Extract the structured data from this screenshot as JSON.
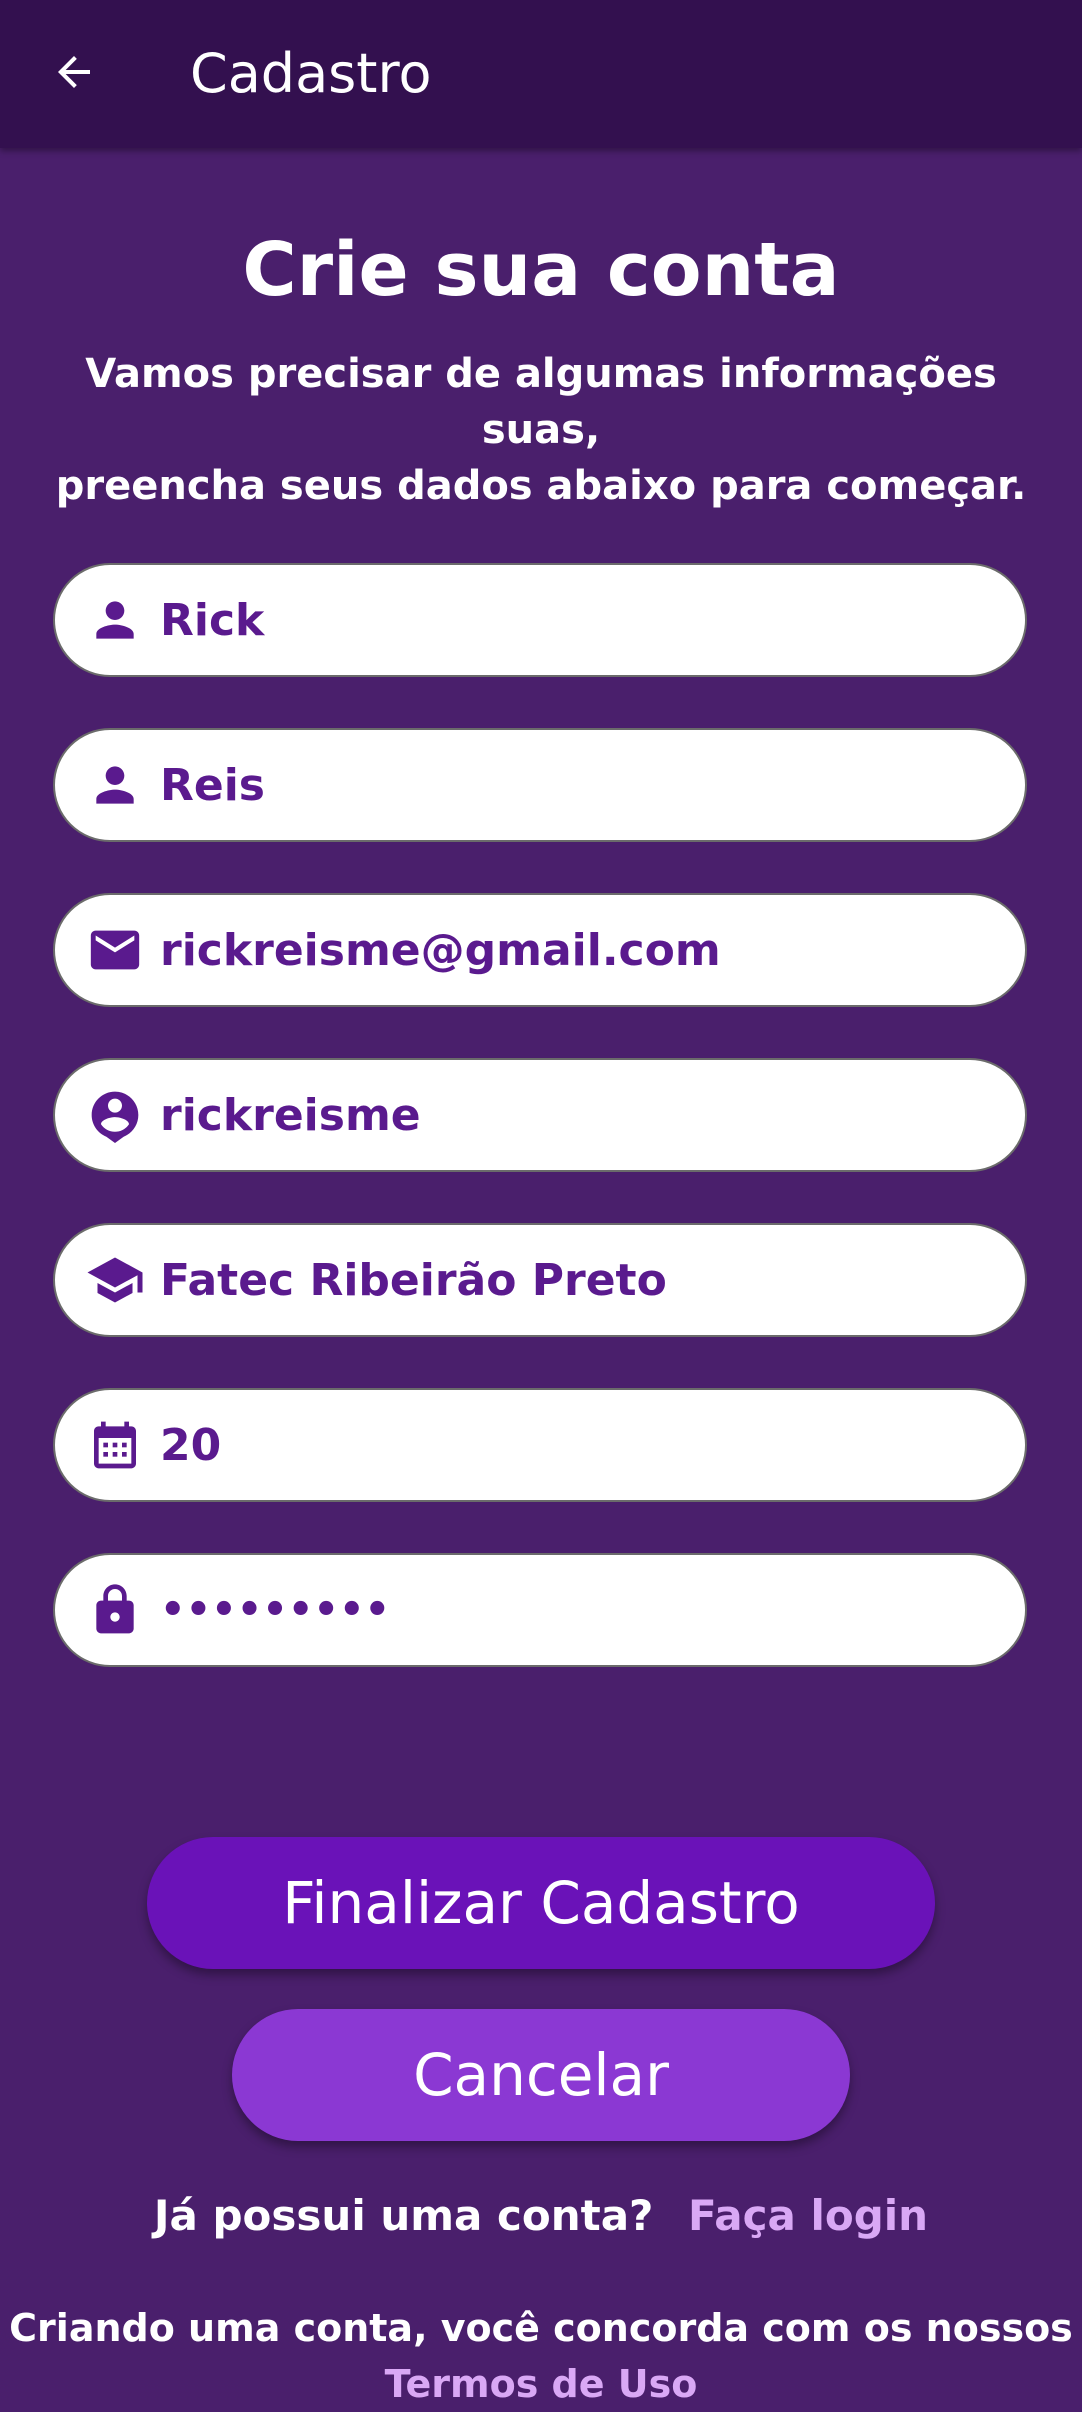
{
  "appbar": {
    "title": "Cadastro",
    "back_icon": "arrow-left-icon"
  },
  "header": {
    "title": "Crie sua conta",
    "subtitle_line1": "Vamos precisar de algumas informações suas,",
    "subtitle_line2": "preencha seus dados abaixo para começar."
  },
  "form": {
    "first_name": {
      "value": "Rick",
      "icon": "person-icon"
    },
    "last_name": {
      "value": "Reis",
      "icon": "person-icon"
    },
    "email": {
      "value": "rickreisme@gmail.com",
      "icon": "mail-icon"
    },
    "username": {
      "value": "rickreisme",
      "icon": "account-circle-icon"
    },
    "institution": {
      "value": "Fatec Ribeirão Preto",
      "icon": "graduation-cap-icon"
    },
    "age": {
      "value": "20",
      "icon": "calendar-icon"
    },
    "password": {
      "value": "•••••••••",
      "icon": "lock-icon"
    }
  },
  "actions": {
    "submit_label": "Finalizar Cadastro",
    "cancel_label": "Cancelar"
  },
  "login": {
    "question": "Já possui uma conta?",
    "link": "Faça login"
  },
  "terms": {
    "text": "Criando uma conta, você concorda com os nossos",
    "link": "Termos de Uso"
  },
  "colors": {
    "background": "#4a1f6c",
    "appbar": "#33104f",
    "primary_button": "#6a12b8",
    "secondary_button": "#8b38d3",
    "field_text": "#5a1a8e",
    "link": "#d9a8f5"
  }
}
